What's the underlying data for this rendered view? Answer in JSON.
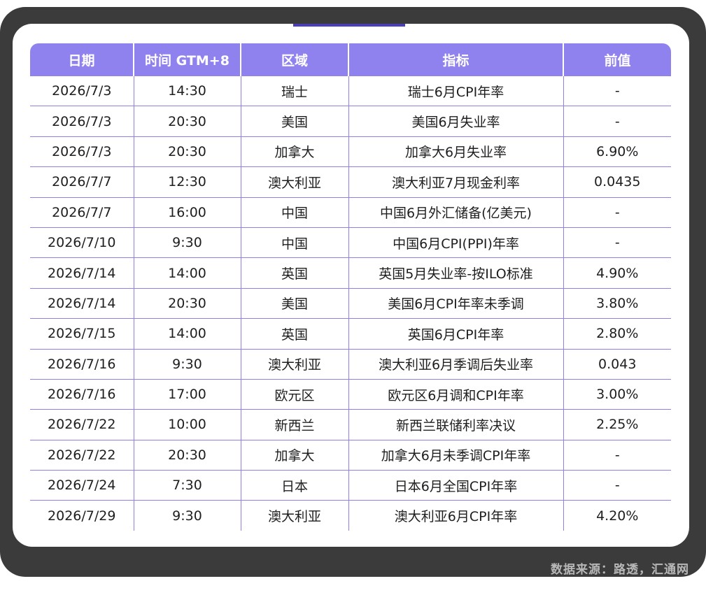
{
  "table": {
    "headers": {
      "date": "日期",
      "time": "时间 GTM+8",
      "region": "区域",
      "indicator": "指标",
      "previous": "前值"
    },
    "rows": [
      {
        "date": "2026/7/3",
        "time": "14:30",
        "region": "瑞士",
        "indicator": "瑞士6月CPI年率",
        "previous": "-"
      },
      {
        "date": "2026/7/3",
        "time": "20:30",
        "region": "美国",
        "indicator": "美国6月失业率",
        "previous": "-"
      },
      {
        "date": "2026/7/3",
        "time": "20:30",
        "region": "加拿大",
        "indicator": "加拿大6月失业率",
        "previous": "6.90%"
      },
      {
        "date": "2026/7/7",
        "time": "12:30",
        "region": "澳大利亚",
        "indicator": "澳大利亚7月现金利率",
        "previous": "0.0435"
      },
      {
        "date": "2026/7/7",
        "time": "16:00",
        "region": "中国",
        "indicator": "中国6月外汇储备(亿美元)",
        "previous": "-"
      },
      {
        "date": "2026/7/10",
        "time": "9:30",
        "region": "中国",
        "indicator": "中国6月CPI(PPI)年率",
        "previous": "-"
      },
      {
        "date": "2026/7/14",
        "time": "14:00",
        "region": "英国",
        "indicator": "英国5月失业率-按ILO标准",
        "previous": "4.90%"
      },
      {
        "date": "2026/7/14",
        "time": "20:30",
        "region": "美国",
        "indicator": "美国6月CPI年率未季调",
        "previous": "3.80%"
      },
      {
        "date": "2026/7/15",
        "time": "14:00",
        "region": "英国",
        "indicator": "英国6月CPI年率",
        "previous": "2.80%"
      },
      {
        "date": "2026/7/16",
        "time": "9:30",
        "region": "澳大利亚",
        "indicator": "澳大利亚6月季调后失业率",
        "previous": "0.043"
      },
      {
        "date": "2026/7/16",
        "time": "17:00",
        "region": "欧元区",
        "indicator": "欧元区6月调和CPI年率",
        "previous": "3.00%"
      },
      {
        "date": "2026/7/22",
        "time": "10:00",
        "region": "新西兰",
        "indicator": "新西兰联储利率决议",
        "previous": "2.25%"
      },
      {
        "date": "2026/7/22",
        "time": "20:30",
        "region": "加拿大",
        "indicator": "加拿大6月未季调CPI年率",
        "previous": "-"
      },
      {
        "date": "2026/7/24",
        "time": "7:30",
        "region": "日本",
        "indicator": "日本6月全国CPI年率",
        "previous": "-"
      },
      {
        "date": "2026/7/29",
        "time": "9:30",
        "region": "澳大利亚",
        "indicator": "澳大利亚6月CPI年率",
        "previous": "4.20%"
      }
    ]
  },
  "source": "数据来源：路透，汇通网",
  "colors": {
    "header_bg": "#9082ee",
    "border": "#8d80e8",
    "frame": "#3b3b3b",
    "accent": "#4a3fb0",
    "source_text": "#b8b8b8"
  }
}
